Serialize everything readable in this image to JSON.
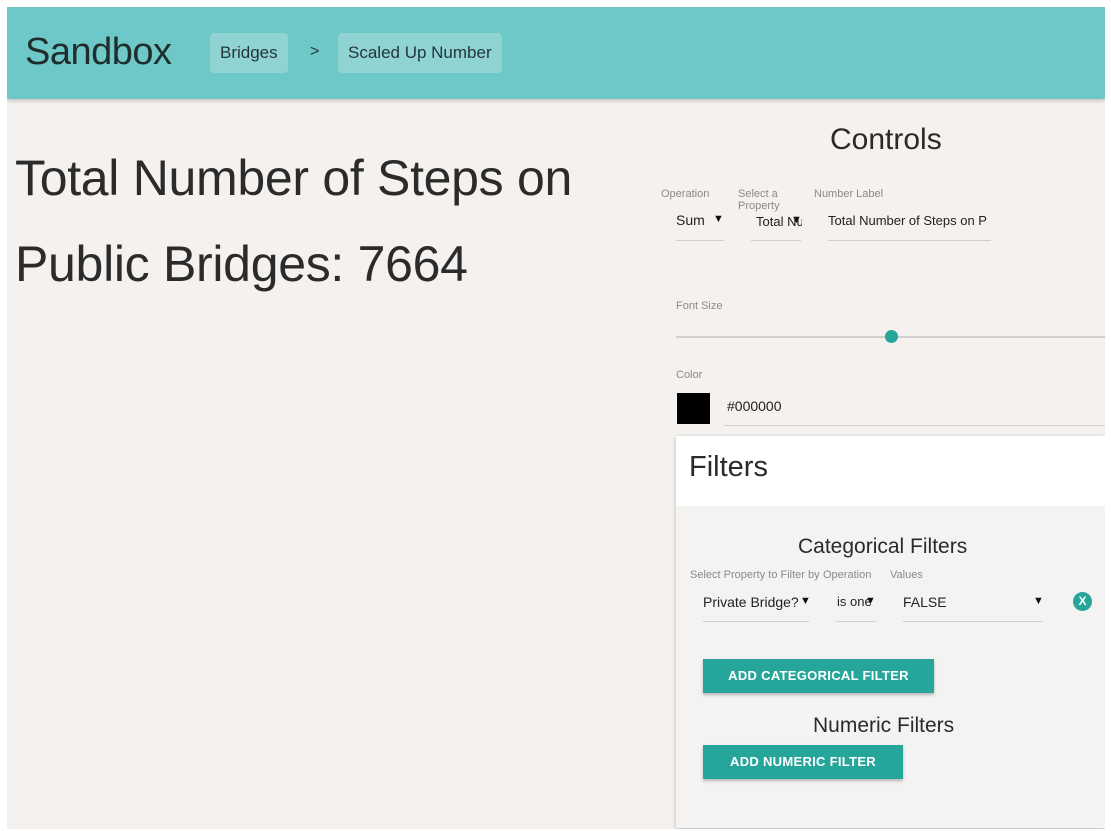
{
  "header": {
    "app_title": "Sandbox",
    "breadcrumbs": [
      "Bridges",
      "Scaled Up Number"
    ],
    "separator": ">"
  },
  "main": {
    "display_text": "Total Number of Steps on Public Bridges: 7664"
  },
  "controls": {
    "title": "Controls",
    "operation": {
      "label": "Operation",
      "value": "Sum"
    },
    "property": {
      "label": "Select a Property",
      "value": "Total Nu"
    },
    "number_label": {
      "label": "Number Label",
      "value": "Total Number of Steps on P"
    },
    "font_size": {
      "label": "Font Size",
      "level": 0.5
    },
    "color": {
      "label": "Color",
      "value": "#000000",
      "swatch": "#000000"
    }
  },
  "filters": {
    "title": "Filters",
    "categorical": {
      "title": "Categorical Filters",
      "columns": [
        "Select Property to Filter by",
        "Operation",
        "Values"
      ],
      "rows": [
        {
          "property": "Private Bridge?",
          "operation": "is one",
          "value": "FALSE",
          "remove_label": "X"
        }
      ],
      "add_button": "ADD CATEGORICAL FILTER"
    },
    "numeric": {
      "title": "Numeric Filters",
      "add_button": "ADD NUMERIC FILTER"
    }
  },
  "colors": {
    "header_bg": "#6fc8c8",
    "accent": "#26a69a",
    "page_bg": "#f4f1ee"
  }
}
